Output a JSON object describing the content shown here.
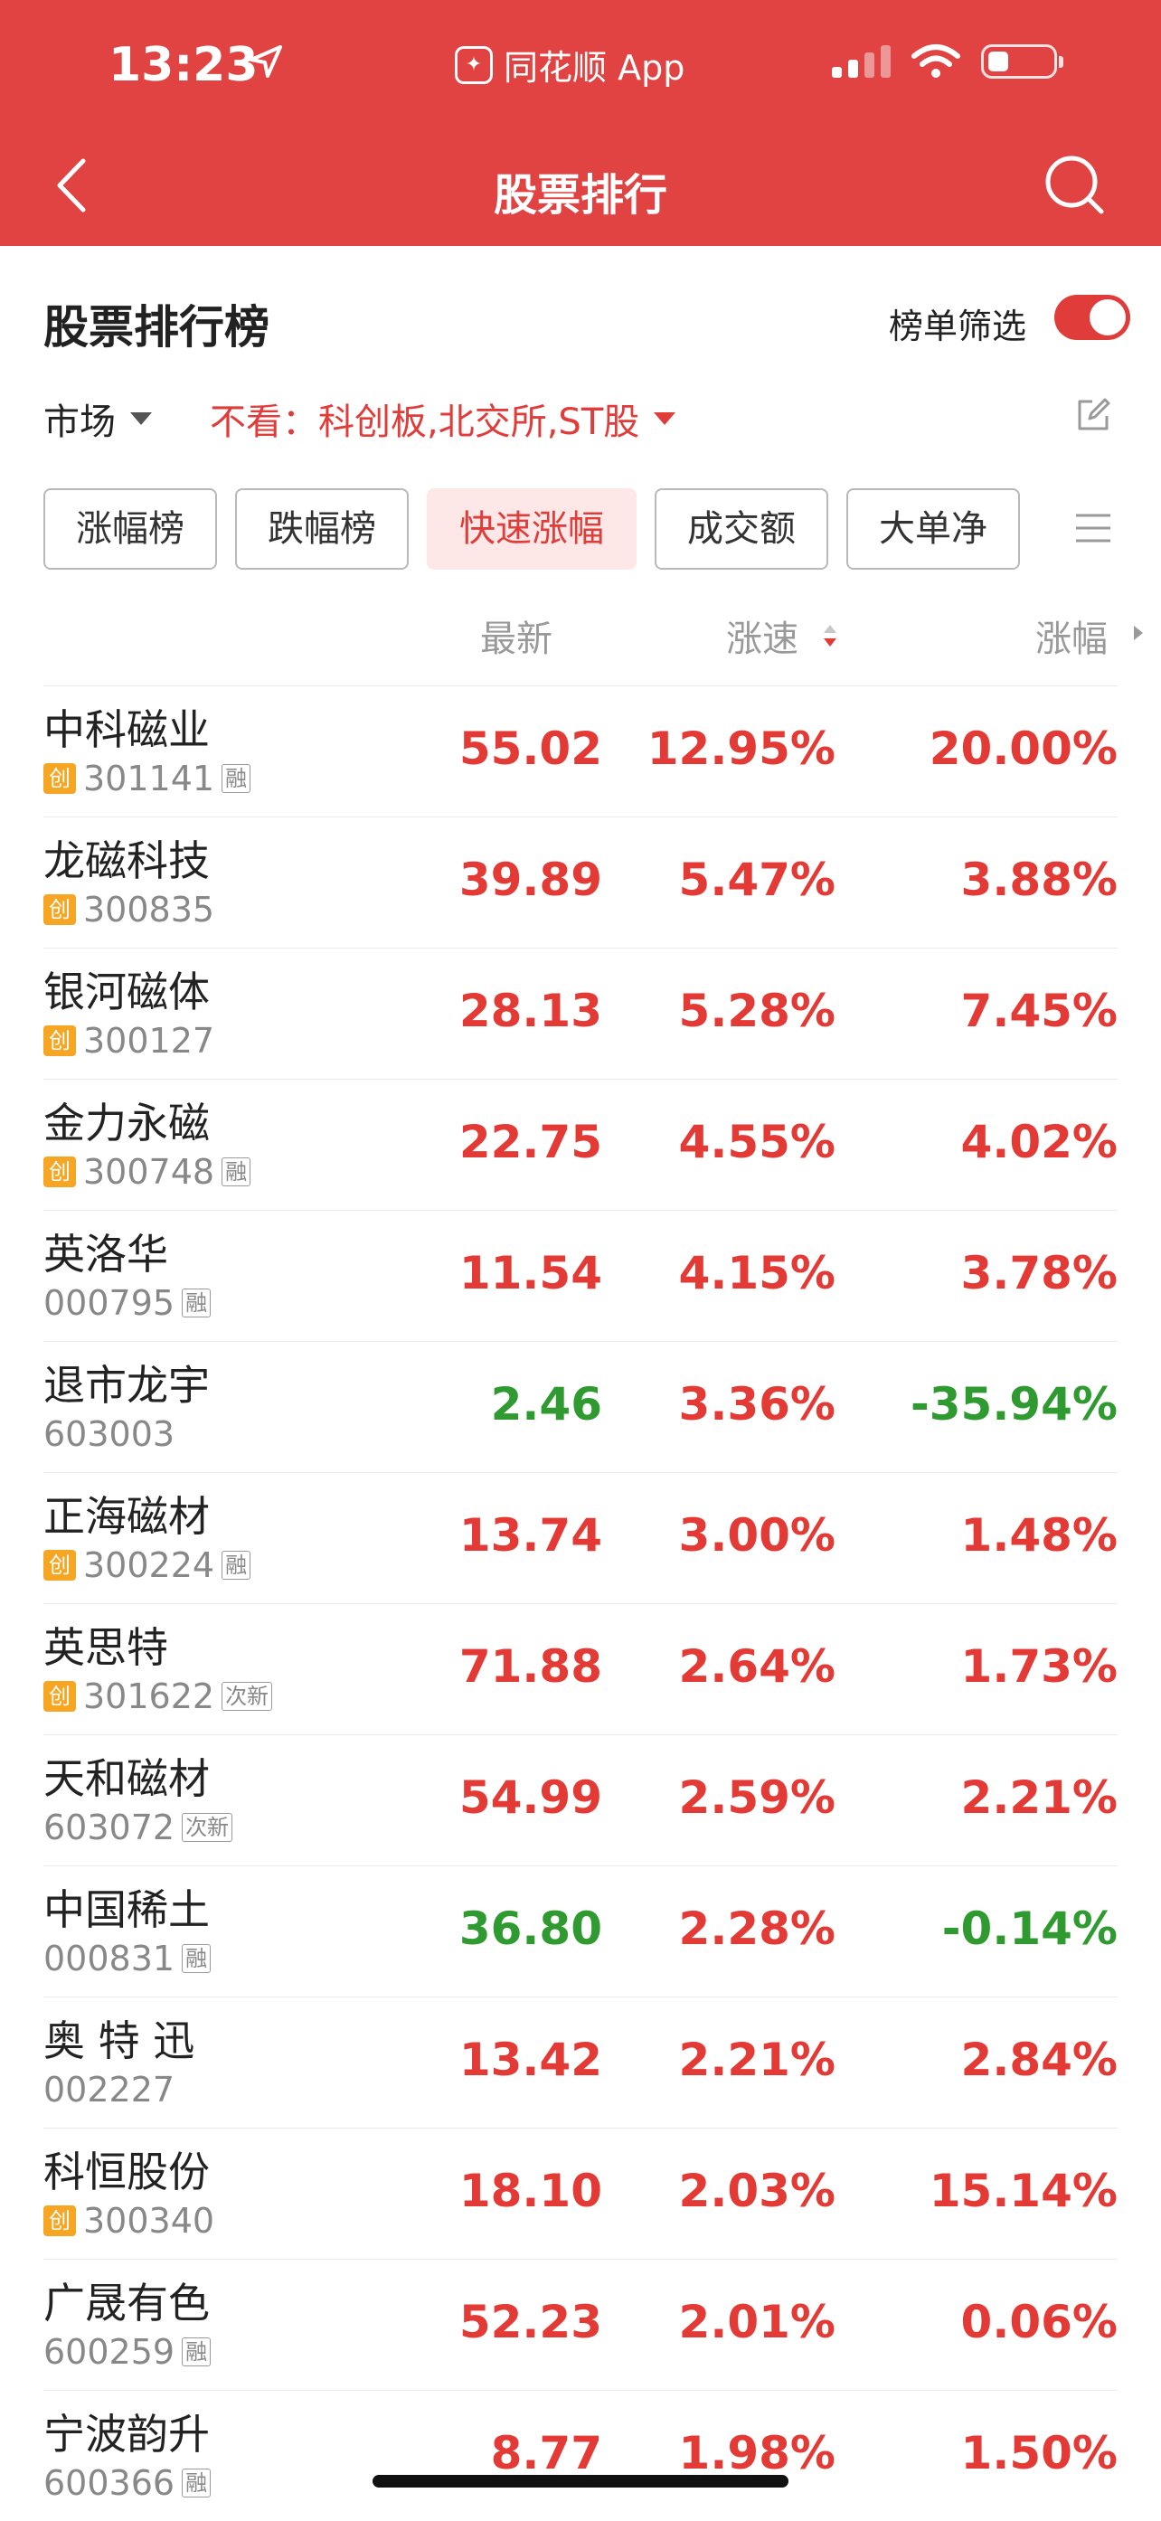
{
  "status_bar": {
    "time": "13:23",
    "app_label": "同花顺 App"
  },
  "nav": {
    "title": "股票排行"
  },
  "list": {
    "title": "股票排行榜",
    "filter_label": "榜单筛选",
    "filter_on": true
  },
  "filters": {
    "market_label": "市场",
    "exclude_label": "不看：科创板,北交所,ST股"
  },
  "tabs": [
    "涨幅榜",
    "跌幅榜",
    "快速涨幅",
    "成交额",
    "大单净"
  ],
  "active_tab": 2,
  "columns": {
    "latest": "最新",
    "speed": "涨速",
    "change": "涨幅"
  },
  "colors": {
    "header": "#e04342",
    "up": "#e33a36",
    "down": "#2f9a2f",
    "chuang_badge": "#f6a623"
  },
  "stocks": [
    {
      "name": "中科磁业",
      "code": "301141",
      "chuang": "创",
      "tag": "融",
      "price": "55.02",
      "speed": "12.95%",
      "change": "20.00%",
      "price_dir": "up",
      "change_dir": "up"
    },
    {
      "name": "龙磁科技",
      "code": "300835",
      "chuang": "创",
      "tag": "",
      "price": "39.89",
      "speed": "5.47%",
      "change": "3.88%",
      "price_dir": "up",
      "change_dir": "up"
    },
    {
      "name": "银河磁体",
      "code": "300127",
      "chuang": "创",
      "tag": "",
      "price": "28.13",
      "speed": "5.28%",
      "change": "7.45%",
      "price_dir": "up",
      "change_dir": "up"
    },
    {
      "name": "金力永磁",
      "code": "300748",
      "chuang": "创",
      "tag": "融",
      "price": "22.75",
      "speed": "4.55%",
      "change": "4.02%",
      "price_dir": "up",
      "change_dir": "up"
    },
    {
      "name": "英洛华",
      "code": "000795",
      "chuang": "",
      "tag": "融",
      "price": "11.54",
      "speed": "4.15%",
      "change": "3.78%",
      "price_dir": "up",
      "change_dir": "up"
    },
    {
      "name": "退市龙宇",
      "code": "603003",
      "chuang": "",
      "tag": "",
      "price": "2.46",
      "speed": "3.36%",
      "change": "-35.94%",
      "price_dir": "down",
      "change_dir": "down"
    },
    {
      "name": "正海磁材",
      "code": "300224",
      "chuang": "创",
      "tag": "融",
      "price": "13.74",
      "speed": "3.00%",
      "change": "1.48%",
      "price_dir": "up",
      "change_dir": "up"
    },
    {
      "name": "英思特",
      "code": "301622",
      "chuang": "创",
      "tag": "次新",
      "price": "71.88",
      "speed": "2.64%",
      "change": "1.73%",
      "price_dir": "up",
      "change_dir": "up"
    },
    {
      "name": "天和磁材",
      "code": "603072",
      "chuang": "",
      "tag": "次新",
      "price": "54.99",
      "speed": "2.59%",
      "change": "2.21%",
      "price_dir": "up",
      "change_dir": "up"
    },
    {
      "name": "中国稀土",
      "code": "000831",
      "chuang": "",
      "tag": "融",
      "price": "36.80",
      "speed": "2.28%",
      "change": "-0.14%",
      "price_dir": "down",
      "change_dir": "down"
    },
    {
      "name": "奥 特 迅",
      "code": "002227",
      "chuang": "",
      "tag": "",
      "price": "13.42",
      "speed": "2.21%",
      "change": "2.84%",
      "price_dir": "up",
      "change_dir": "up"
    },
    {
      "name": "科恒股份",
      "code": "300340",
      "chuang": "创",
      "tag": "",
      "price": "18.10",
      "speed": "2.03%",
      "change": "15.14%",
      "price_dir": "up",
      "change_dir": "up"
    },
    {
      "name": "广晟有色",
      "code": "600259",
      "chuang": "",
      "tag": "融",
      "price": "52.23",
      "speed": "2.01%",
      "change": "0.06%",
      "price_dir": "up",
      "change_dir": "up"
    },
    {
      "name": "宁波韵升",
      "code": "600366",
      "chuang": "",
      "tag": "融",
      "price": "8.77",
      "speed": "1.98%",
      "change": "1.50%",
      "price_dir": "up",
      "change_dir": "up"
    }
  ]
}
